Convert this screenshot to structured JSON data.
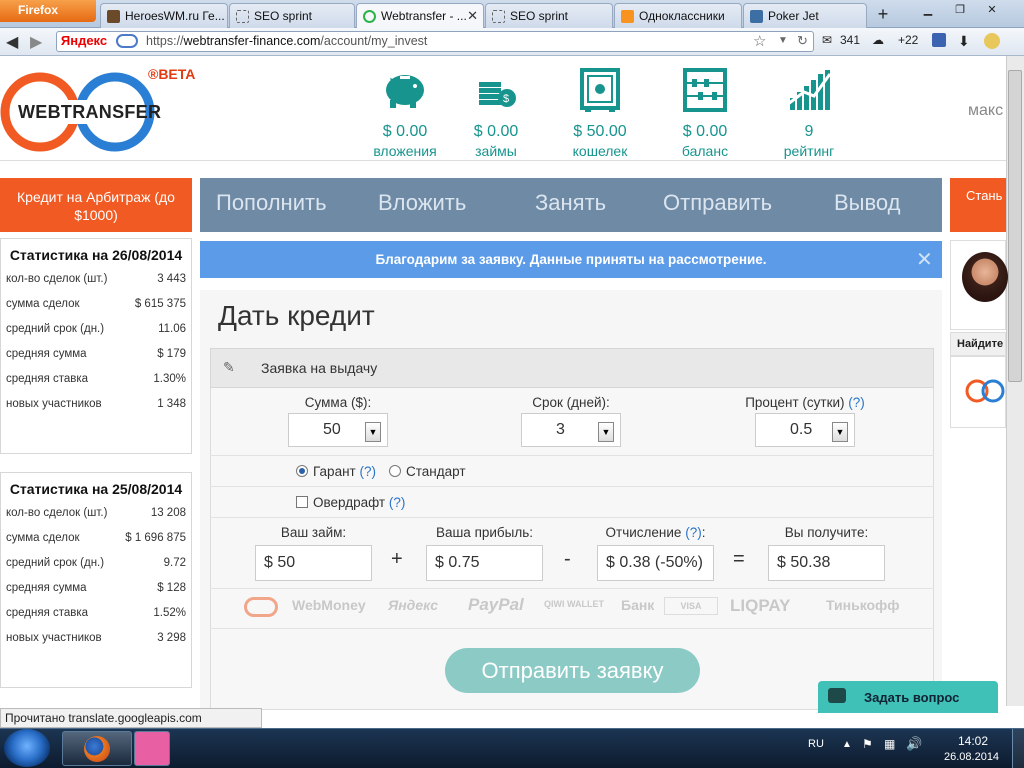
{
  "browser": {
    "menu_button": "Firefox",
    "tabs": [
      {
        "label": "HeroesWM.ru Ге...",
        "active": false
      },
      {
        "label": "SEO sprint",
        "active": false
      },
      {
        "label": "Webtransfer - ...",
        "active": true
      },
      {
        "label": "SEO sprint",
        "active": false
      },
      {
        "label": "Одноклассники",
        "active": false
      },
      {
        "label": "Poker Jet",
        "active": false
      }
    ],
    "new_tab": "+",
    "search_engine": "Яндекс",
    "url_prefix": "https://",
    "url_domain": "webtransfer-finance.com",
    "url_path": "/account/my_invest",
    "mail_count": "341",
    "weather": "+22"
  },
  "header": {
    "logo_text": "WEBTRANSFER",
    "beta": "®BETA",
    "stats": [
      {
        "value": "$ 0.00",
        "label": "вложения",
        "icon": "piggy-bank-icon"
      },
      {
        "value": "$ 0.00",
        "label": "займы",
        "icon": "coins-icon"
      },
      {
        "value": "$ 50.00",
        "label": "кошелек",
        "icon": "safe-icon"
      },
      {
        "value": "$ 0.00",
        "label": "баланс",
        "icon": "abacus-icon"
      },
      {
        "value": "9",
        "label": "рейтинг",
        "icon": "rating-chart-icon"
      }
    ],
    "user_name": "макс"
  },
  "left": {
    "promo": "Кредит на Арбитраж (до $1000)",
    "stat_blocks": [
      {
        "title": "Статистика на 26/08/2014",
        "rows": [
          {
            "label": "кол-во сделок (шт.)",
            "value": "3 443"
          },
          {
            "label": "сумма сделок",
            "value": "$ 615 375"
          },
          {
            "label": "средний срок (дн.)",
            "value": "11.06"
          },
          {
            "label": "средняя сумма",
            "value": "$ 179"
          },
          {
            "label": "средняя ставка",
            "value": "1.30%"
          },
          {
            "label": "новых участников",
            "value": "1 348"
          }
        ]
      },
      {
        "title": "Статистика на 25/08/2014",
        "rows": [
          {
            "label": "кол-во сделок (шт.)",
            "value": "13 208"
          },
          {
            "label": "сумма сделок",
            "value": "$ 1 696 875"
          },
          {
            "label": "средний срок (дн.)",
            "value": "9.72"
          },
          {
            "label": "средняя сумма",
            "value": "$ 128"
          },
          {
            "label": "средняя ставка",
            "value": "1.52%"
          },
          {
            "label": "новых участников",
            "value": "3 298"
          }
        ]
      }
    ]
  },
  "menu": [
    "Пополнить",
    "Вложить",
    "Занять",
    "Отправить",
    "Вывод"
  ],
  "right_promo": "Стань с",
  "alert": "Благодарим за заявку. Данные приняты на рассмотрение.",
  "form": {
    "title": "Дать кредит",
    "section": "Заявка на выдачу",
    "amount_label": "Сумма ($):",
    "amount_value": "50",
    "term_label": "Срок (дней):",
    "term_value": "3",
    "percent_label": "Процент (сутки)",
    "percent_value": "0.5",
    "help": "(?)",
    "radio_guarant": "Гарант",
    "radio_standard": "Стандарт",
    "overdraft": "Овердрафт",
    "loan_label": "Ваш займ:",
    "loan_value": "$ 50",
    "profit_label": "Ваша прибыль:",
    "profit_value": "$ 0.75",
    "fee_label": "Отчисление",
    "fee_value": "$ 0.38 (-50%)",
    "receive_label": "Вы получите:",
    "receive_value": "$ 50.38",
    "op_plus": "+",
    "op_minus": "-",
    "op_eq": "=",
    "colon": ":",
    "payments": [
      "WebMoney",
      "Яндекс",
      "PayPal",
      "QIWI WALLET",
      "Банк",
      "VISA",
      "LIQPAY",
      "Тинькофф"
    ],
    "submit": "Отправить заявку"
  },
  "right": {
    "find": "Найдите в"
  },
  "chat": "Задать вопрос",
  "status_bar": "Прочитано translate.googleapis.com",
  "taskbar": {
    "lang": "RU",
    "time": "14:02",
    "date": "26.08.2014"
  },
  "colors": {
    "accent_teal": "#17948e",
    "orange": "#f15a22",
    "menu_blue": "#6e8aa5",
    "alert_blue": "#5b9be8"
  }
}
